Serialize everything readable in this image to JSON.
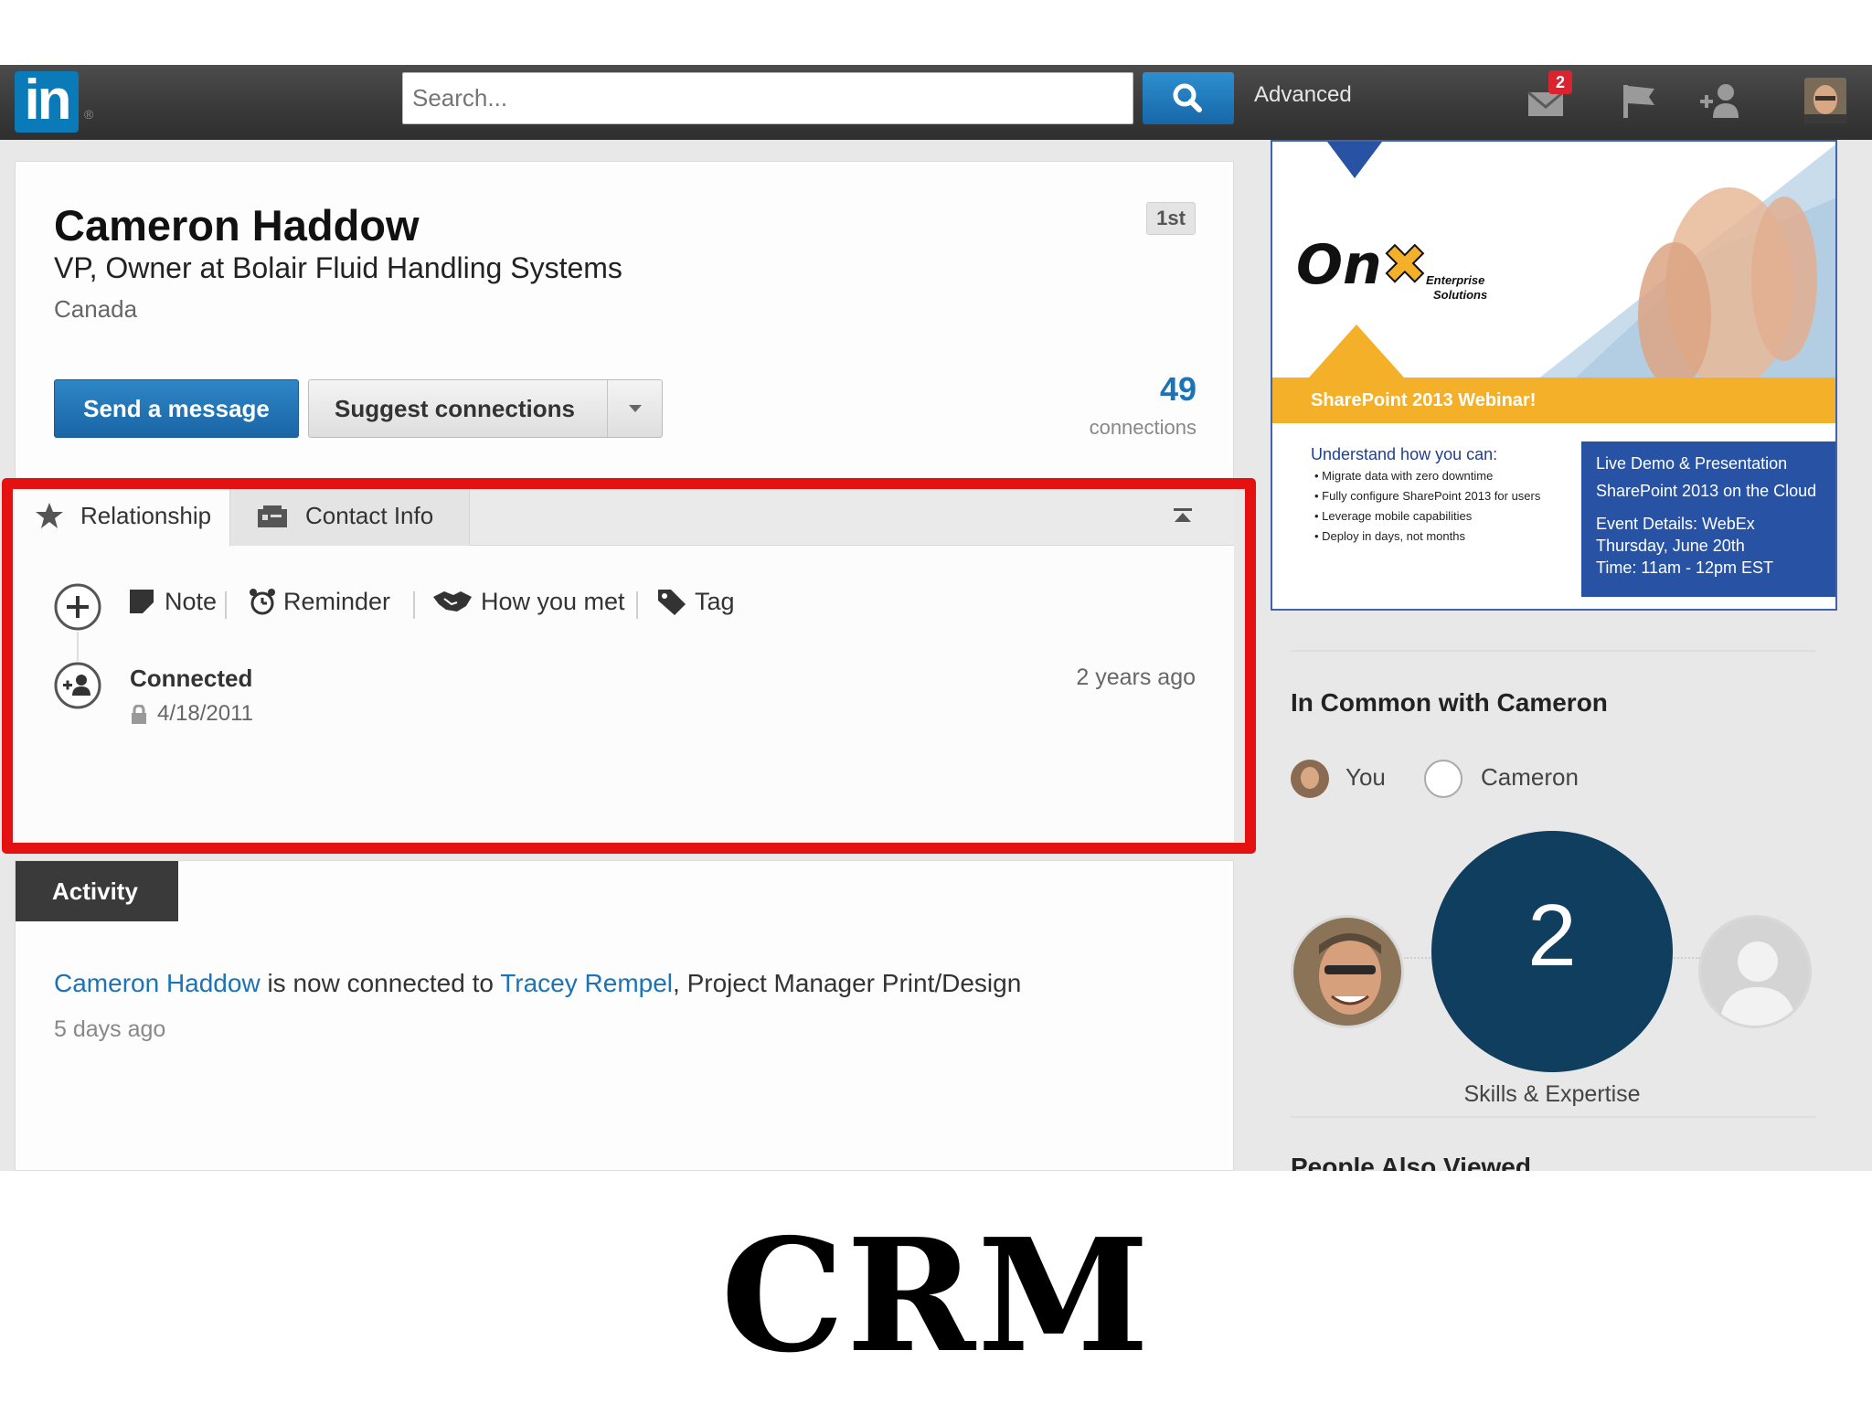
{
  "navbar": {
    "logo_text": "in",
    "search_placeholder": "Search...",
    "advanced_label": "Advanced",
    "messages_badge": "2"
  },
  "profile": {
    "name": "Cameron Haddow",
    "headline": "VP, Owner at Bolair Fluid Handling Systems",
    "location": "Canada",
    "degree": "1st",
    "send_message_label": "Send a message",
    "suggest_connections_label": "Suggest connections",
    "connections_count": "49",
    "connections_label": "connections"
  },
  "relationship": {
    "tabs": [
      {
        "label": "Relationship",
        "icon": "star-icon",
        "active": true
      },
      {
        "label": "Contact Info",
        "icon": "contact-card-icon",
        "active": false
      }
    ],
    "actions": [
      {
        "label": "Note",
        "icon": "note-icon"
      },
      {
        "label": "Reminder",
        "icon": "alarm-clock-icon"
      },
      {
        "label": "How you met",
        "icon": "handshake-icon"
      },
      {
        "label": "Tag",
        "icon": "tag-icon"
      }
    ],
    "connected_label": "Connected",
    "connected_date": "4/18/2011",
    "connected_ago": "2 years ago"
  },
  "activity": {
    "tab_label": "Activity",
    "actor": "Cameron Haddow",
    "verb": " is now connected to ",
    "target": "Tracey Rempel",
    "target_title": ", Project Manager Print/Design",
    "time": "5 days ago"
  },
  "ad": {
    "brand": "On",
    "brand_sub_1": "Enterprise",
    "brand_sub_2": "Solutions",
    "banner": "SharePoint 2013 Webinar!",
    "learn_title": "Understand how you can:",
    "bullets": [
      "Migrate data with zero downtime",
      "Fully configure SharePoint 2013 for users",
      "Leverage mobile capabilities",
      "Deploy in days, not months"
    ],
    "box_lines": [
      "Live Demo & Presentation",
      "SharePoint 2013 on the Cloud",
      "Event Details: WebEx",
      "Thursday, June 20th",
      "Time: 11am - 12pm EST"
    ],
    "accent_color": "#f5b02a",
    "box_color": "#2853a5"
  },
  "in_common": {
    "title": "In Common with Cameron",
    "you_label": "You",
    "cameron_label": "Cameron",
    "shared_count": "2",
    "skills_label": "Skills & Expertise",
    "people_also_viewed": "People Also Viewed"
  },
  "caption": "CRM",
  "colors": {
    "linkedin_blue": "#0a7ab8",
    "highlight_red": "#e51010",
    "circle_navy": "#0f3e5f"
  }
}
